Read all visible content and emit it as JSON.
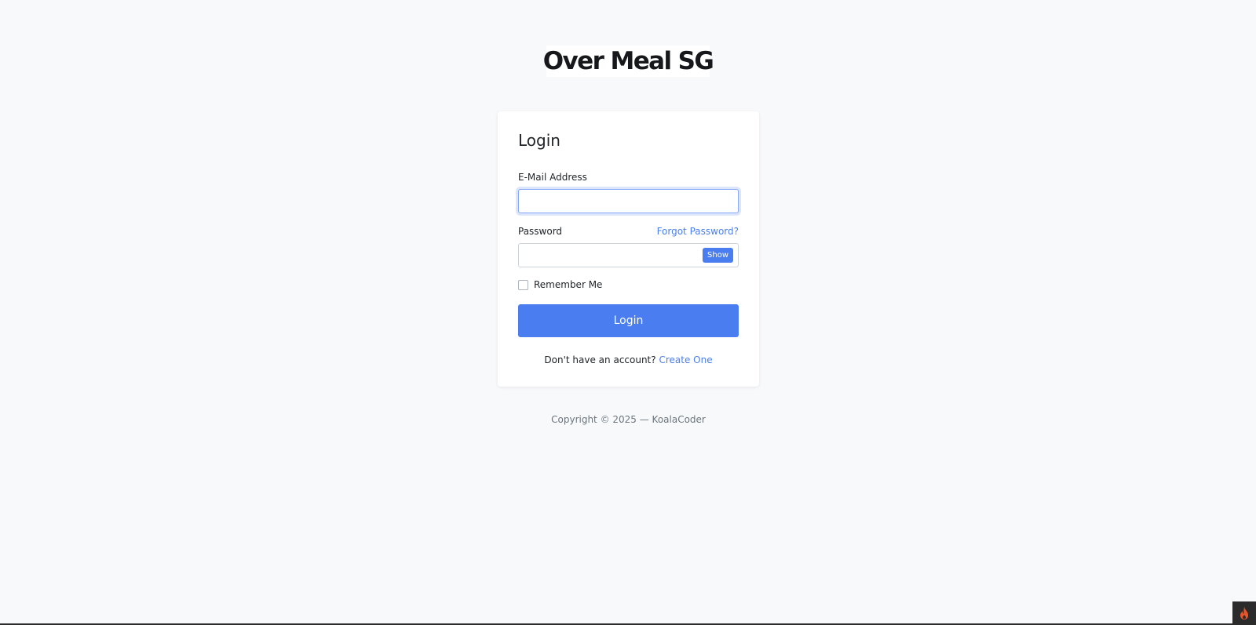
{
  "brand": {
    "name": "Over Meal SG"
  },
  "login_form": {
    "title": "Login",
    "email_label": "E-Mail Address",
    "email_value": "",
    "password_label": "Password",
    "password_value": "",
    "forgot_password_label": "Forgot Password?",
    "show_password_label": "Show",
    "remember_me_label": "Remember Me",
    "remember_me_checked": false,
    "submit_label": "Login",
    "signup_prompt": "Don't have an account?",
    "signup_link_label": "Create One"
  },
  "footer": {
    "copyright": "Copyright © 2025 — KoalaCoder"
  },
  "colors": {
    "accent": "#4a7ef0",
    "background": "#f8f9fb",
    "card": "#ffffff",
    "badge_bg": "#2b2b2b",
    "flame": "#e8552a"
  },
  "icons": {
    "corner_badge": "flame-icon"
  }
}
